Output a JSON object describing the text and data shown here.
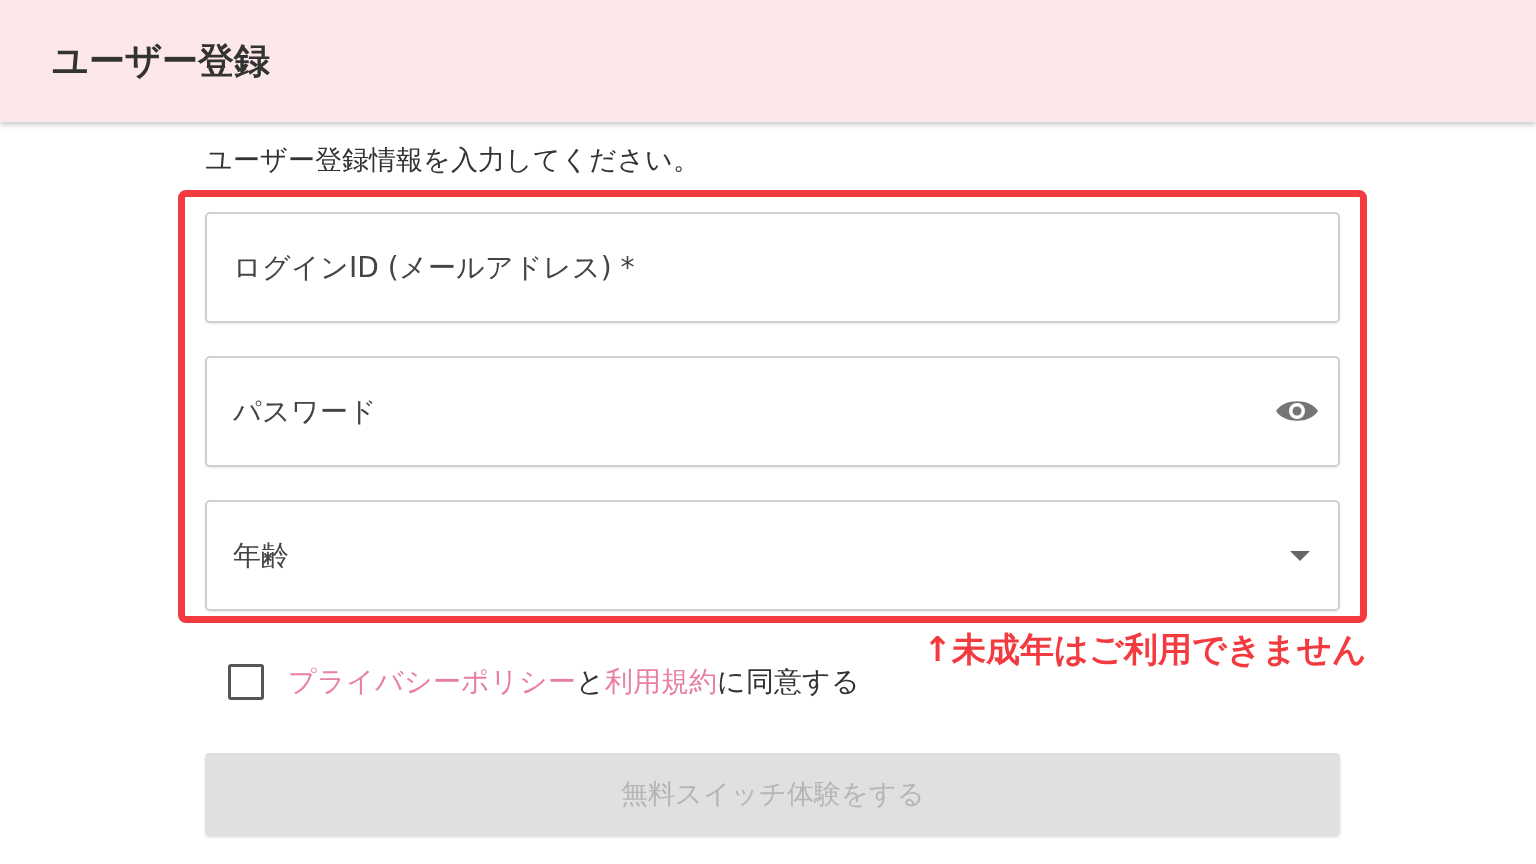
{
  "header": {
    "title": "ユーザー登録"
  },
  "intro": "ユーザー登録情報を入力してください。",
  "fields": [
    {
      "kind": "text",
      "placeholder": "ログインID (メールアドレス) *"
    },
    {
      "kind": "password",
      "placeholder": "パスワード"
    },
    {
      "kind": "select",
      "label": "年齢"
    }
  ],
  "annotation": "↑未成年はご利用できません",
  "agreement": {
    "checked": false,
    "parts": [
      {
        "kind": "link",
        "text": "プライバシーポリシー"
      },
      {
        "kind": "text",
        "text": "と"
      },
      {
        "kind": "link",
        "text": "利用規約"
      },
      {
        "kind": "text",
        "text": "に同意する"
      }
    ]
  },
  "submit": {
    "label": "無料スイッチ体験をする",
    "disabled": true
  }
}
